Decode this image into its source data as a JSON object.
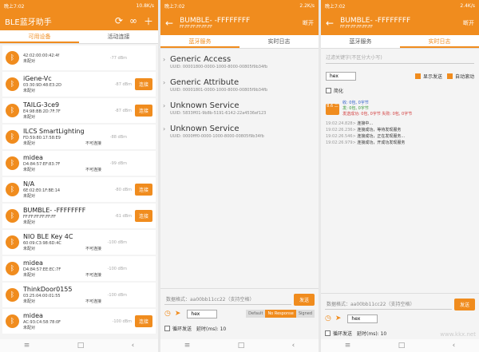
{
  "status": {
    "time": "晚上7:02",
    "signal": "4G"
  },
  "p1": {
    "status_speed": "10.8K/s",
    "title": "BLE蓝牙助手",
    "tabs": [
      "可用设备",
      "活动连接"
    ],
    "connect_label": "连接",
    "devices": [
      {
        "name": "",
        "mac": "42:02:00:00:42:4f",
        "state": "未配对",
        "conn": "",
        "rssi": "-77 dBm",
        "button": false
      },
      {
        "name": "iGene-Vc",
        "mac": "03:30:9D:48:E3:2D",
        "state": "未配对",
        "conn": "",
        "rssi": "-87 dBm",
        "button": true
      },
      {
        "name": "TAILG-3ce9",
        "mac": "E4:98:BB:2D:7F:7F",
        "state": "未配对",
        "conn": "",
        "rssi": "-87 dBm",
        "button": true
      },
      {
        "name": "ILCS SmartLighting",
        "mac": "FD:59:80:17:58:E9",
        "state": "未配对",
        "conn": "不可连接",
        "rssi": "-88 dBm",
        "button": false
      },
      {
        "name": "midea",
        "mac": "D4:84:57:EF:83:7F",
        "state": "未配对",
        "conn": "不可连接",
        "rssi": "-99 dBm",
        "button": false
      },
      {
        "name": "N/A",
        "mac": "6E:02:E0:1F:BE:14",
        "state": "未配对",
        "conn": "",
        "rssi": "-80 dBm",
        "button": true
      },
      {
        "name": "BUMBLE- -FFFFFFFF",
        "mac": "FF:FF:FF:FF:FF:FF",
        "state": "未配对",
        "conn": "",
        "rssi": "-61 dBm",
        "button": true
      },
      {
        "name": "NIO BLE Key 4C",
        "mac": "60:09:C3:98:6D:4C",
        "state": "未配对",
        "conn": "不可连接",
        "rssi": "-100 dBm",
        "button": false
      },
      {
        "name": "midea",
        "mac": "D4:84:57:EE:EC:7F",
        "state": "未配对",
        "conn": "不可连接",
        "rssi": "-100 dBm",
        "button": false
      },
      {
        "name": "ThinkDoor0155",
        "mac": "03:25:04:00:01:55",
        "state": "未配对",
        "conn": "不可连接",
        "rssi": "-100 dBm",
        "button": false
      },
      {
        "name": "midea",
        "mac": "AC:93:C4:58:78:0F",
        "state": "未配对",
        "conn": "",
        "rssi": "-100 dBm",
        "button": true
      }
    ]
  },
  "p2": {
    "status_speed": "2.2K/s",
    "title": "BUMBLE- -FFFFFFFF",
    "subtitle": "FF:FF:FF:FF:FF:FF",
    "action": "断开",
    "tabs": [
      "蓝牙服务",
      "实时日志"
    ],
    "services": [
      {
        "name": "Generic Access",
        "uuid": "UUID: 00001800-0000-1000-8000-00805f9b34fb"
      },
      {
        "name": "Generic Attribute",
        "uuid": "UUID: 00001801-0000-1000-8000-00805f9b34fb"
      },
      {
        "name": "Unknown Service",
        "uuid": "UUID: 5833ff01-9b8b-5191-6142-22a4536ef123"
      },
      {
        "name": "Unknown Service",
        "uuid": "UUID: 0000fff0-0000-1000-8000-00805f9b34fb"
      }
    ],
    "format_placeholder": "数据格式：aa00bb11cc22（支持空格）",
    "send": "发送",
    "encoding": "hex",
    "write_modes": [
      "Default",
      "No Response",
      "Signed"
    ],
    "loop_send": "循环发送",
    "delay": "延时(ms): 10"
  },
  "p3": {
    "status_speed": "2.4K/s",
    "title": "BUMBLE- -FFFFFFFF",
    "subtitle": "FF:FF:FF:FF:FF:FF",
    "action": "断开",
    "tabs": [
      "蓝牙服务",
      "实时日志"
    ],
    "filter_placeholder": "过滤关键字(不区分大小写)",
    "encoding": "hex",
    "show_send": "显示发送",
    "auto_scroll": "自动滚动",
    "simplify": "简化",
    "stat_badge": "8.6 二",
    "stat_lines": [
      "收: 0包, 0字节",
      "发: 0包, 0字节",
      "发送成功: 0包, 0字节  失败: 0包, 0字节"
    ],
    "logs": [
      {
        "t": "19:02:24.828>",
        "m": "连接中..."
      },
      {
        "t": "19:02:26.236>",
        "m": "连接成功，等待发现服务"
      },
      {
        "t": "19:02:26.546>",
        "m": "连接成功，正在发现服务..."
      },
      {
        "t": "19:02:26.979>",
        "m": "连接成功，开成功发现服务"
      }
    ],
    "format_placeholder": "数据格式：aa00bb11cc22（支持空格）",
    "send": "发送",
    "loop_send": "循环发送",
    "delay": "延时(ms): 10"
  },
  "watermark": "www.kkx.net"
}
